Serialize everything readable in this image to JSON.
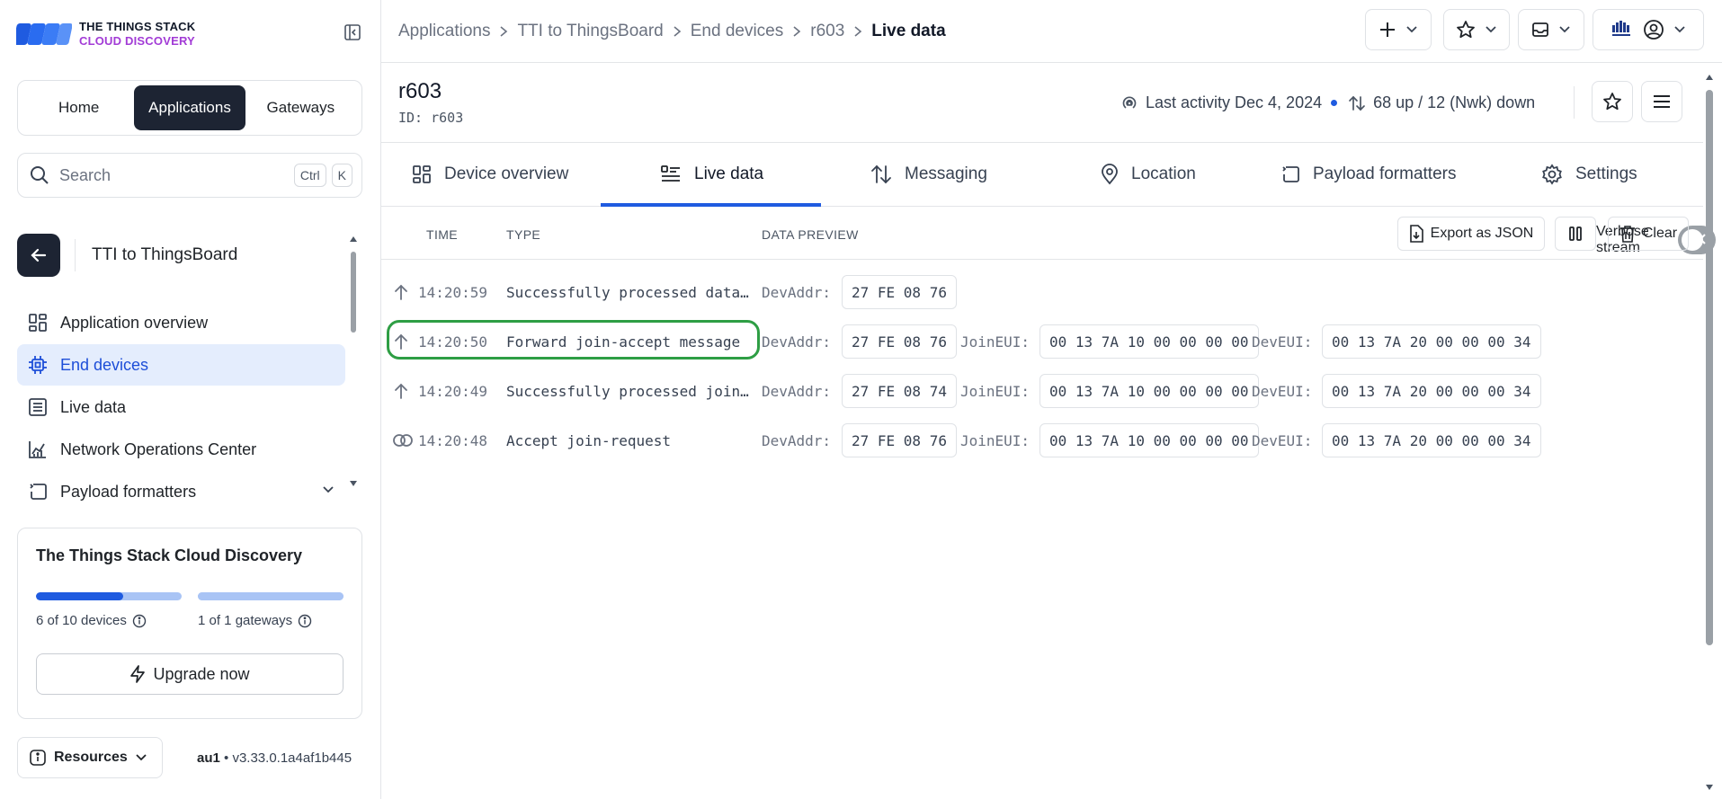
{
  "brand": {
    "line1": "THE THINGS STACK",
    "line2": "CLOUD DISCOVERY"
  },
  "nav_tabs": [
    {
      "label": "Home",
      "active": false
    },
    {
      "label": "Applications",
      "active": true
    },
    {
      "label": "Gateways",
      "active": false
    }
  ],
  "search": {
    "placeholder": "Search",
    "shortcut_1": "Ctrl",
    "shortcut_2": "K"
  },
  "app": {
    "name": "TTI to ThingsBoard"
  },
  "menu": [
    {
      "label": "Application overview",
      "icon": "grid-icon",
      "active": false
    },
    {
      "label": "End devices",
      "icon": "chip-icon",
      "active": true
    },
    {
      "label": "Live data",
      "icon": "list-icon",
      "active": false
    },
    {
      "label": "Network Operations Center",
      "icon": "chart-icon",
      "active": false
    },
    {
      "label": "Payload formatters",
      "icon": "code-icon",
      "active": false
    }
  ],
  "plan": {
    "title": "The Things Stack Cloud Discovery",
    "devices_label": "6 of 10 devices",
    "devices_fraction": 0.6,
    "gateways_label": "1 of 1 gateways",
    "gateways_fraction": 1.0,
    "upgrade_label": "Upgrade now"
  },
  "footer": {
    "resources_label": "Resources",
    "cluster": "au1",
    "version": "v3.33.0.1a4af1b445"
  },
  "breadcrumbs": [
    "Applications",
    "TTI to ThingsBoard",
    "End devices",
    "r603"
  ],
  "breadcrumb_current": "Live data",
  "device": {
    "name": "r603",
    "id_label": "ID:",
    "id": "r603",
    "last_activity": "Last activity Dec 4, 2024",
    "traffic": "68 up / 12 (Nwk) down"
  },
  "tabs": [
    {
      "label": "Device overview",
      "icon": "grid-icon"
    },
    {
      "label": "Live data",
      "icon": "list-icon",
      "active": true
    },
    {
      "label": "Messaging",
      "icon": "updown-icon"
    },
    {
      "label": "Location",
      "icon": "pin-icon"
    },
    {
      "label": "Payload formatters",
      "icon": "code-icon"
    },
    {
      "label": "Settings",
      "icon": "gear-icon"
    }
  ],
  "table": {
    "col_time": "TIME",
    "col_type": "TYPE",
    "col_preview": "DATA PREVIEW",
    "verbose_label": "Verbose stream",
    "export_label": "Export as JSON",
    "clear_label": "Clear",
    "rows": [
      {
        "direction": "up",
        "time": "14:20:59",
        "type": "Successfully processed data message",
        "devaddr_label": "DevAddr:",
        "devaddr": "27 FE 08 76"
      },
      {
        "direction": "up",
        "time": "14:20:50",
        "type": "Forward join-accept message",
        "devaddr_label": "DevAddr:",
        "devaddr": "27 FE 08 76",
        "joineui_label": "JoinEUI:",
        "joineui": "00 13 7A 10 00 00 00 00",
        "deveui_label": "DevEUI:",
        "deveui": "00 13 7A 20 00 00 00 34"
      },
      {
        "direction": "up",
        "time": "14:20:49",
        "type": "Successfully processed join-request",
        "devaddr_label": "DevAddr:",
        "devaddr": "27 FE 08 74",
        "joineui_label": "JoinEUI:",
        "joineui": "00 13 7A 10 00 00 00 00",
        "deveui_label": "DevEUI:",
        "deveui": "00 13 7A 20 00 00 00 34"
      },
      {
        "direction": "link",
        "time": "14:20:48",
        "type": "Accept join-request",
        "devaddr_label": "DevAddr:",
        "devaddr": "27 FE 08 76",
        "joineui_label": "JoinEUI:",
        "joineui": "00 13 7A 10 00 00 00 00",
        "deveui_label": "DevEUI:",
        "deveui": "00 13 7A 20 00 00 00 34"
      }
    ]
  },
  "colors": {
    "accent": "#1f5be0",
    "dark": "#1d2433",
    "highlight": "#2e9e44",
    "brand_purple": "#a23bd6"
  }
}
